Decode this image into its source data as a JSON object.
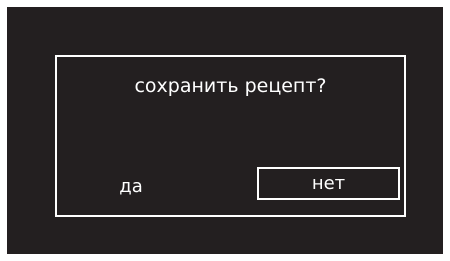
{
  "dialog": {
    "question": "сохранить рецепт?",
    "yes_label": "да",
    "no_label": "нет"
  },
  "colors": {
    "background": "#231f20",
    "foreground": "#ffffff"
  }
}
